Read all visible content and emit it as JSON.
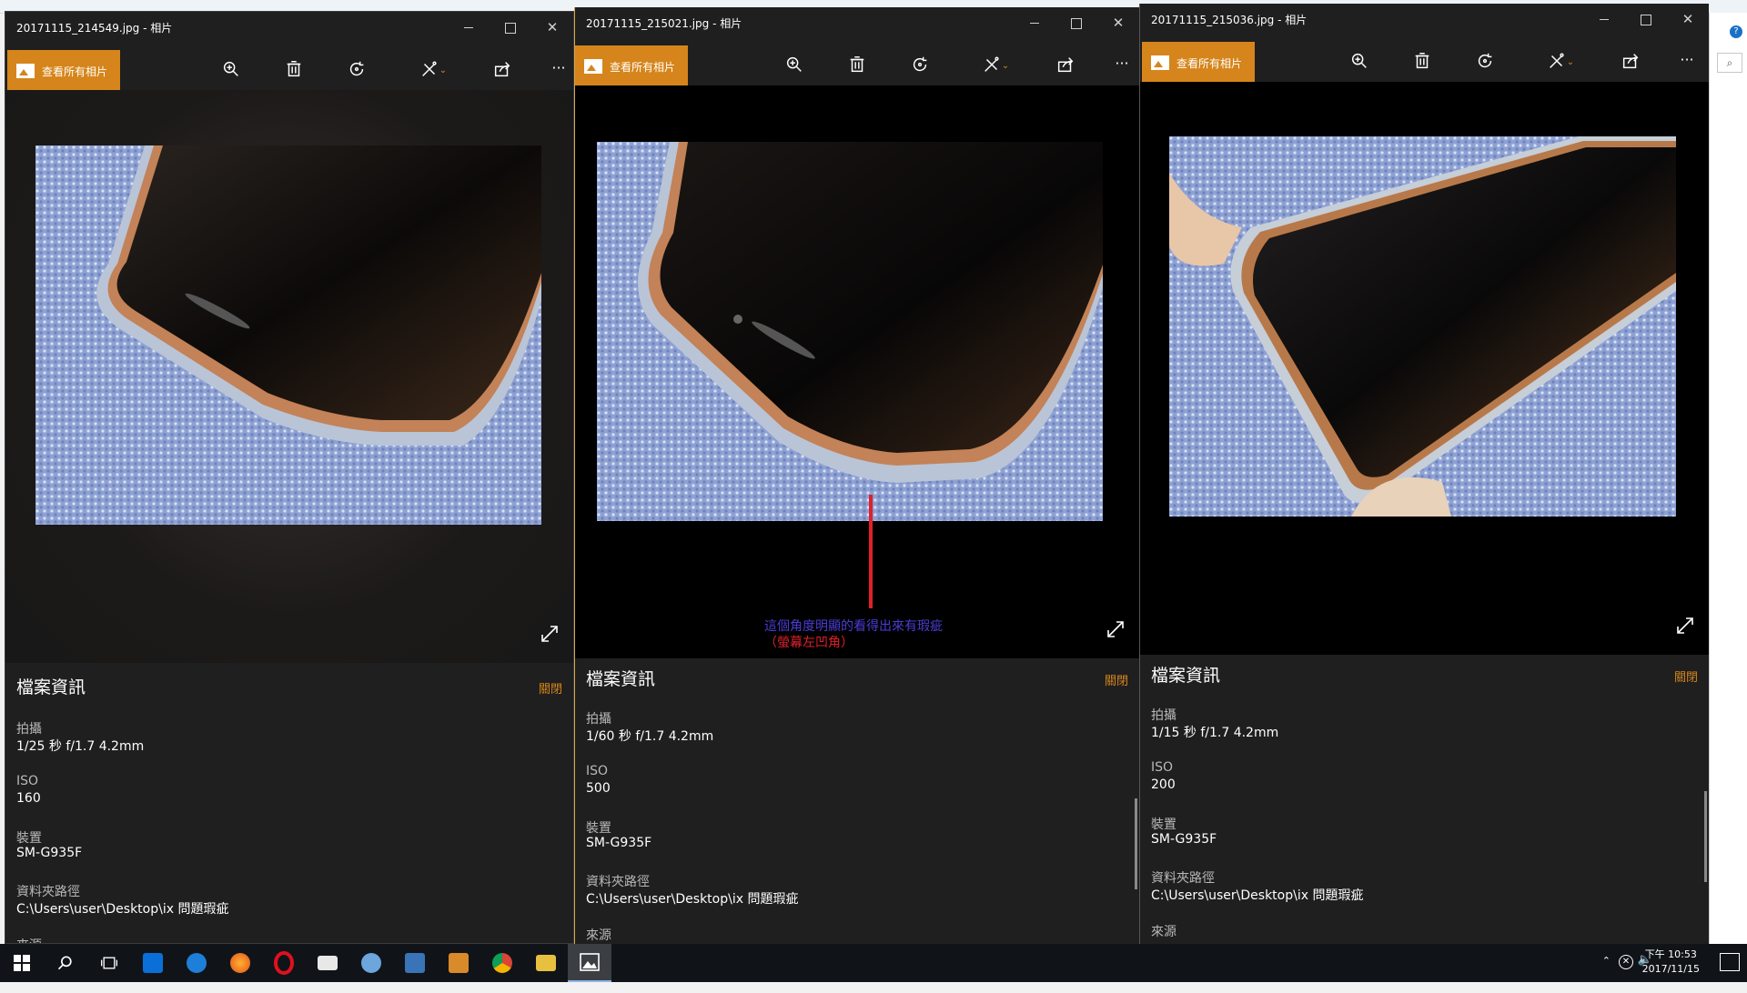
{
  "windows": [
    {
      "title": "20171115_214549.jpg - 相片",
      "view_all_label": "查看所有相片",
      "info": {
        "header": "檔案資訊",
        "close_label": "關閉",
        "fields": [
          {
            "label": "拍攝",
            "value": "1/25 秒 f/1.7 4.2mm"
          },
          {
            "label": "ISO",
            "value": "160"
          },
          {
            "label": "裝置",
            "value": "SM-G935F"
          },
          {
            "label": "資料夾路徑",
            "value": "C:\\Users\\user\\Desktop\\ix 問題瑕疵"
          },
          {
            "label": "來源",
            "value": ""
          }
        ]
      }
    },
    {
      "title": "20171115_215021.jpg - 相片",
      "view_all_label": "查看所有相片",
      "annotation": {
        "line1": "這個角度明顯的看得出來有瑕疵",
        "line2": "（螢幕左凹角）",
        "line1_color": "#4a3cd6",
        "line2_color": "#e0202a"
      },
      "info": {
        "header": "檔案資訊",
        "close_label": "關閉",
        "fields": [
          {
            "label": "拍攝",
            "value": "1/60 秒 f/1.7 4.2mm"
          },
          {
            "label": "ISO",
            "value": "500"
          },
          {
            "label": "裝置",
            "value": "SM-G935F"
          },
          {
            "label": "資料夾路徑",
            "value": "C:\\Users\\user\\Desktop\\ix 問題瑕疵"
          },
          {
            "label": "來源",
            "value": ""
          }
        ]
      }
    },
    {
      "title": "20171115_215036.jpg - 相片",
      "view_all_label": "查看所有相片",
      "info": {
        "header": "檔案資訊",
        "close_label": "關閉",
        "fields": [
          {
            "label": "拍攝",
            "value": "1/15 秒 f/1.7 4.2mm"
          },
          {
            "label": "ISO",
            "value": "200"
          },
          {
            "label": "裝置",
            "value": "SM-G935F"
          },
          {
            "label": "資料夾路徑",
            "value": "C:\\Users\\user\\Desktop\\ix 問題瑕疵"
          },
          {
            "label": "來源",
            "value": ""
          }
        ]
      }
    }
  ],
  "toolbar_icons": [
    "zoom-icon",
    "trash-icon",
    "rotate-icon",
    "edit-icon",
    "share-icon",
    "more-icon"
  ],
  "taskbar": {
    "apps": [
      "windows-start-icon",
      "search-icon",
      "task-view-icon",
      "store-icon",
      "edge-icon",
      "firefox-icon",
      "opera-icon",
      "mail-icon",
      "paint-icon",
      "media-icon",
      "photoshop-icon",
      "chrome-icon",
      "explorer-icon",
      "photos-icon"
    ],
    "clock_time": "下午 10:53",
    "clock_date": "2017/11/15"
  },
  "colors": {
    "accent": "#d5851b",
    "window_bg": "#1f1f1f",
    "taskbar_bg": "#101418"
  }
}
